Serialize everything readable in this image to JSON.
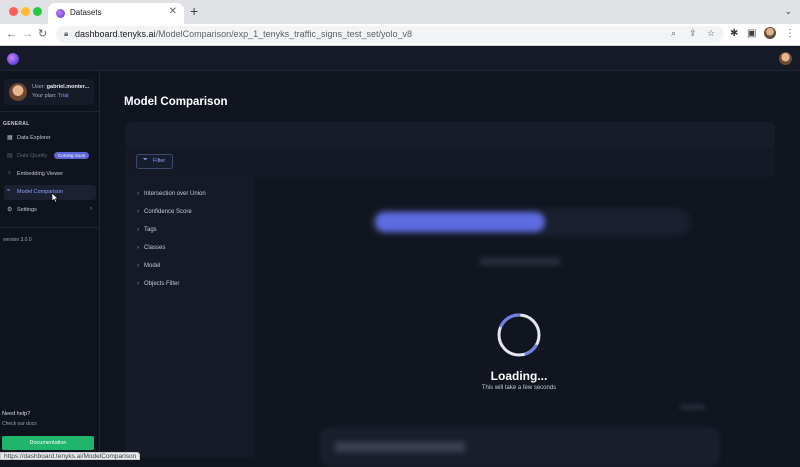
{
  "browser": {
    "tab_title": "Datasets",
    "tab_close": "✕",
    "new_tab": "+",
    "url_host": "dashboard.tenyks.ai",
    "url_path": "/ModelComparison/exp_1_tenyks_traffic_signs_test_set/yolo_v8",
    "status_url": "https://dashboard.tenyks.ai/ModelComparison"
  },
  "sidebar": {
    "user_prefix": "User:",
    "user_name": "gabriel.monter...",
    "plan_prefix": "Your plan:",
    "plan": "Trial",
    "section": "GENERAL",
    "items": [
      {
        "label": "Data Explorer"
      },
      {
        "label": "Data Quality",
        "badge": "Coming Soon"
      },
      {
        "label": "Embedding Viewer"
      },
      {
        "label": "Model Comparison"
      },
      {
        "label": "Settings"
      }
    ],
    "version": "version 3.0.0",
    "help_title": "Need help?",
    "help_sub": "Check our docs",
    "doc_button": "Documentation"
  },
  "main": {
    "title": "Model Comparison",
    "filter_button": "Filter",
    "filters": [
      "Intersection over Union",
      "Confidence Score",
      "Tags",
      "Classes",
      "Model",
      "Objects Filter"
    ],
    "loading_title": "Loading...",
    "loading_sub": "This will take a few seconds"
  },
  "colors": {
    "accent": "#5d6be0",
    "doc_button": "#1fb56b",
    "background": "#11151f"
  }
}
